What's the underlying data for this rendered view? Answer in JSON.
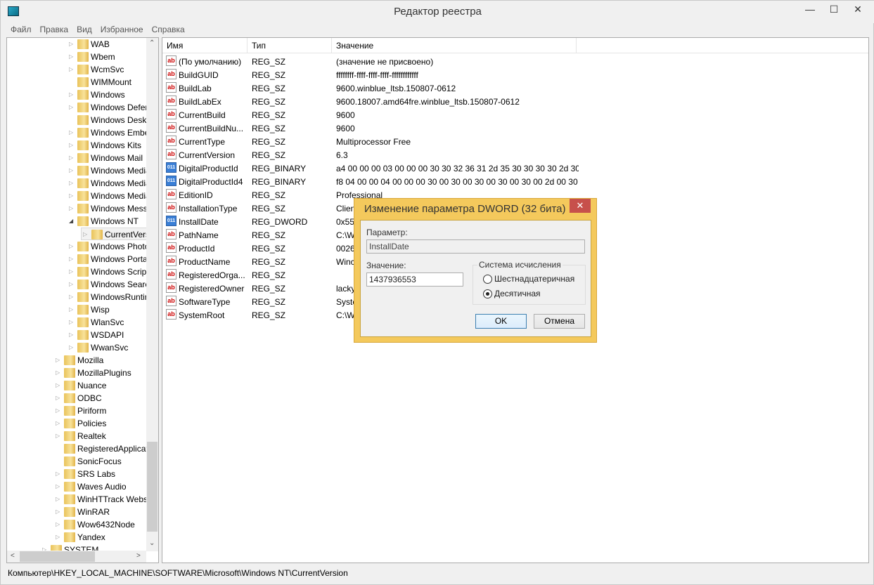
{
  "window": {
    "title": "Редактор реестра",
    "minimize": "—",
    "maximize": "☐",
    "close": "✕"
  },
  "menu": [
    "Файл",
    "Правка",
    "Вид",
    "Избранное",
    "Справка"
  ],
  "tree": [
    {
      "label": "WAB",
      "level": 3,
      "exp": "collapsed"
    },
    {
      "label": "Wbem",
      "level": 3,
      "exp": "collapsed"
    },
    {
      "label": "WcmSvc",
      "level": 3,
      "exp": "collapsed"
    },
    {
      "label": "WIMMount",
      "level": 3,
      "exp": "none"
    },
    {
      "label": "Windows",
      "level": 3,
      "exp": "collapsed"
    },
    {
      "label": "Windows Defender",
      "level": 3,
      "exp": "collapsed"
    },
    {
      "label": "Windows Desktop Search",
      "level": 3,
      "exp": "none"
    },
    {
      "label": "Windows Embedded",
      "level": 3,
      "exp": "collapsed"
    },
    {
      "label": "Windows Kits",
      "level": 3,
      "exp": "collapsed"
    },
    {
      "label": "Windows Mail",
      "level": 3,
      "exp": "collapsed"
    },
    {
      "label": "Windows Media Device Manager",
      "level": 3,
      "exp": "collapsed"
    },
    {
      "label": "Windows Media Foundation",
      "level": 3,
      "exp": "collapsed"
    },
    {
      "label": "Windows Media Player NSS",
      "level": 3,
      "exp": "collapsed"
    },
    {
      "label": "Windows Messaging Subsystem",
      "level": 3,
      "exp": "collapsed"
    },
    {
      "label": "Windows NT",
      "level": 3,
      "exp": "expanded"
    },
    {
      "label": "CurrentVersion",
      "level": 4,
      "exp": "collapsed",
      "selected": true
    },
    {
      "label": "Windows Photo Viewer",
      "level": 3,
      "exp": "collapsed"
    },
    {
      "label": "Windows Portable Devices",
      "level": 3,
      "exp": "collapsed"
    },
    {
      "label": "Windows Script Host",
      "level": 3,
      "exp": "collapsed"
    },
    {
      "label": "Windows Search",
      "level": 3,
      "exp": "collapsed"
    },
    {
      "label": "WindowsRuntime",
      "level": 3,
      "exp": "collapsed"
    },
    {
      "label": "Wisp",
      "level": 3,
      "exp": "collapsed"
    },
    {
      "label": "WlanSvc",
      "level": 3,
      "exp": "collapsed"
    },
    {
      "label": "WSDAPI",
      "level": 3,
      "exp": "collapsed"
    },
    {
      "label": "WwanSvc",
      "level": 3,
      "exp": "collapsed"
    },
    {
      "label": "Mozilla",
      "level": 2,
      "exp": "collapsed"
    },
    {
      "label": "MozillaPlugins",
      "level": 2,
      "exp": "collapsed"
    },
    {
      "label": "Nuance",
      "level": 2,
      "exp": "collapsed"
    },
    {
      "label": "ODBC",
      "level": 2,
      "exp": "collapsed"
    },
    {
      "label": "Piriform",
      "level": 2,
      "exp": "collapsed"
    },
    {
      "label": "Policies",
      "level": 2,
      "exp": "collapsed"
    },
    {
      "label": "Realtek",
      "level": 2,
      "exp": "collapsed"
    },
    {
      "label": "RegisteredApplications",
      "level": 2,
      "exp": "none"
    },
    {
      "label": "SonicFocus",
      "level": 2,
      "exp": "none"
    },
    {
      "label": "SRS Labs",
      "level": 2,
      "exp": "collapsed"
    },
    {
      "label": "Waves Audio",
      "level": 2,
      "exp": "collapsed"
    },
    {
      "label": "WinHTTrack Website Copier",
      "level": 2,
      "exp": "collapsed"
    },
    {
      "label": "WinRAR",
      "level": 2,
      "exp": "collapsed"
    },
    {
      "label": "Wow6432Node",
      "level": 2,
      "exp": "collapsed"
    },
    {
      "label": "Yandex",
      "level": 2,
      "exp": "collapsed"
    },
    {
      "label": "SYSTEM",
      "level": 1,
      "exp": "collapsed"
    }
  ],
  "list": {
    "columns": [
      "Имя",
      "Тип",
      "Значение"
    ],
    "rows": [
      {
        "name": "(По умолчанию)",
        "type": "REG_SZ",
        "value": "(значение не присвоено)",
        "icon": "string"
      },
      {
        "name": "BuildGUID",
        "type": "REG_SZ",
        "value": "ffffffff-ffff-ffff-ffff-ffffffffffff",
        "icon": "string"
      },
      {
        "name": "BuildLab",
        "type": "REG_SZ",
        "value": "9600.winblue_ltsb.150807-0612",
        "icon": "string"
      },
      {
        "name": "BuildLabEx",
        "type": "REG_SZ",
        "value": "9600.18007.amd64fre.winblue_ltsb.150807-0612",
        "icon": "string"
      },
      {
        "name": "CurrentBuild",
        "type": "REG_SZ",
        "value": "9600",
        "icon": "string"
      },
      {
        "name": "CurrentBuildNu...",
        "type": "REG_SZ",
        "value": "9600",
        "icon": "string"
      },
      {
        "name": "CurrentType",
        "type": "REG_SZ",
        "value": "Multiprocessor Free",
        "icon": "string"
      },
      {
        "name": "CurrentVersion",
        "type": "REG_SZ",
        "value": "6.3",
        "icon": "string"
      },
      {
        "name": "DigitalProductId",
        "type": "REG_BINARY",
        "value": "a4 00 00 00 03 00 00 00 30 30 32 36 31 2d 35 30 30 30 30 2d 30 3...",
        "icon": "binary"
      },
      {
        "name": "DigitalProductId4",
        "type": "REG_BINARY",
        "value": "f8 04 00 00 04 00 00 00 30 00 30 00 30 00 30 00 30 00 2d 00 30 00...",
        "icon": "binary"
      },
      {
        "name": "EditionID",
        "type": "REG_SZ",
        "value": "Professional",
        "icon": "string"
      },
      {
        "name": "InstallationType",
        "type": "REG_SZ",
        "value": "Clien",
        "icon": "string"
      },
      {
        "name": "InstallDate",
        "type": "REG_DWORD",
        "value": "0x55b",
        "icon": "binary"
      },
      {
        "name": "PathName",
        "type": "REG_SZ",
        "value": "C:\\W",
        "icon": "string"
      },
      {
        "name": "ProductId",
        "type": "REG_SZ",
        "value": "0026",
        "icon": "string"
      },
      {
        "name": "ProductName",
        "type": "REG_SZ",
        "value": "Winc",
        "icon": "string"
      },
      {
        "name": "RegisteredOrga...",
        "type": "REG_SZ",
        "value": "",
        "icon": "string"
      },
      {
        "name": "RegisteredOwner",
        "type": "REG_SZ",
        "value": "lacky",
        "icon": "string"
      },
      {
        "name": "SoftwareType",
        "type": "REG_SZ",
        "value": "Syste",
        "icon": "string"
      },
      {
        "name": "SystemRoot",
        "type": "REG_SZ",
        "value": "C:\\W",
        "icon": "string"
      }
    ]
  },
  "status": "Компьютер\\HKEY_LOCAL_MACHINE\\SOFTWARE\\Microsoft\\Windows NT\\CurrentVersion",
  "dialog": {
    "title": "Изменение параметра DWORD (32 бита)",
    "close": "✕",
    "param_label": "Параметр:",
    "param_value": "InstallDate",
    "value_label": "Значение:",
    "value": "1437936553",
    "base_label": "Система исчисления",
    "hex_label": "Шестнадцатеричная",
    "dec_label": "Десятичная",
    "selected_base": "dec",
    "ok": "OK",
    "cancel": "Отмена"
  },
  "colors": {
    "dialog_frame": "#f4c95c",
    "close_button": "#c7504b"
  }
}
